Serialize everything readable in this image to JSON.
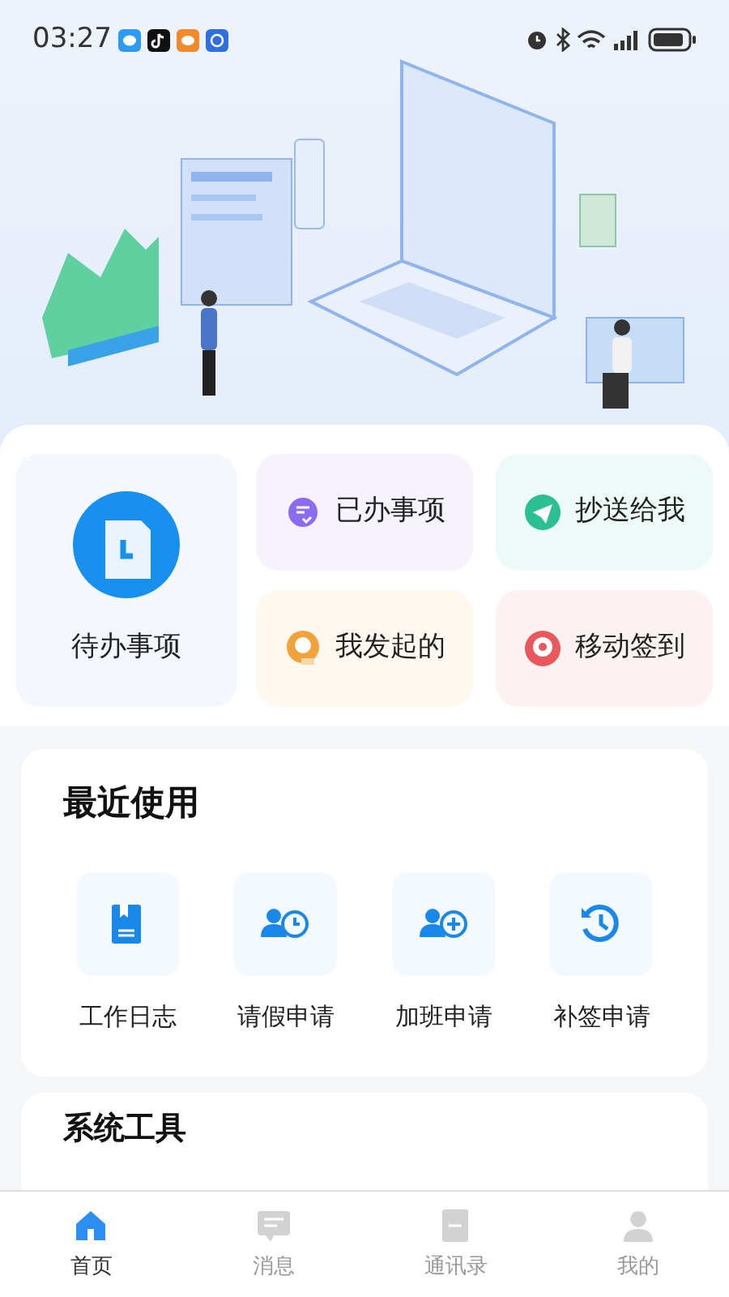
{
  "status_bar": {
    "time": "03:27"
  },
  "quick_actions": {
    "main": {
      "label": "待办事项"
    },
    "items": [
      {
        "label": "已办事项",
        "kind": "done",
        "color": "#8b6cf0"
      },
      {
        "label": "抄送给我",
        "kind": "send",
        "color": "#2bbf94"
      },
      {
        "label": "我发起的",
        "kind": "initiated",
        "color": "#f2a23a"
      },
      {
        "label": "移动签到",
        "kind": "checkin",
        "color": "#e8585c"
      }
    ]
  },
  "recent": {
    "title": "最近使用",
    "items": [
      {
        "label": "工作日志",
        "kind": "journal"
      },
      {
        "label": "请假申请",
        "kind": "leave"
      },
      {
        "label": "加班申请",
        "kind": "overtime"
      },
      {
        "label": "补签申请",
        "kind": "makeup"
      }
    ]
  },
  "system": {
    "title": "系统工具"
  },
  "tabs": [
    {
      "label": "首页",
      "kind": "home",
      "selected": true
    },
    {
      "label": "消息",
      "kind": "message",
      "selected": false
    },
    {
      "label": "通讯录",
      "kind": "contacts",
      "selected": false
    },
    {
      "label": "我的",
      "kind": "profile",
      "selected": false
    }
  ]
}
